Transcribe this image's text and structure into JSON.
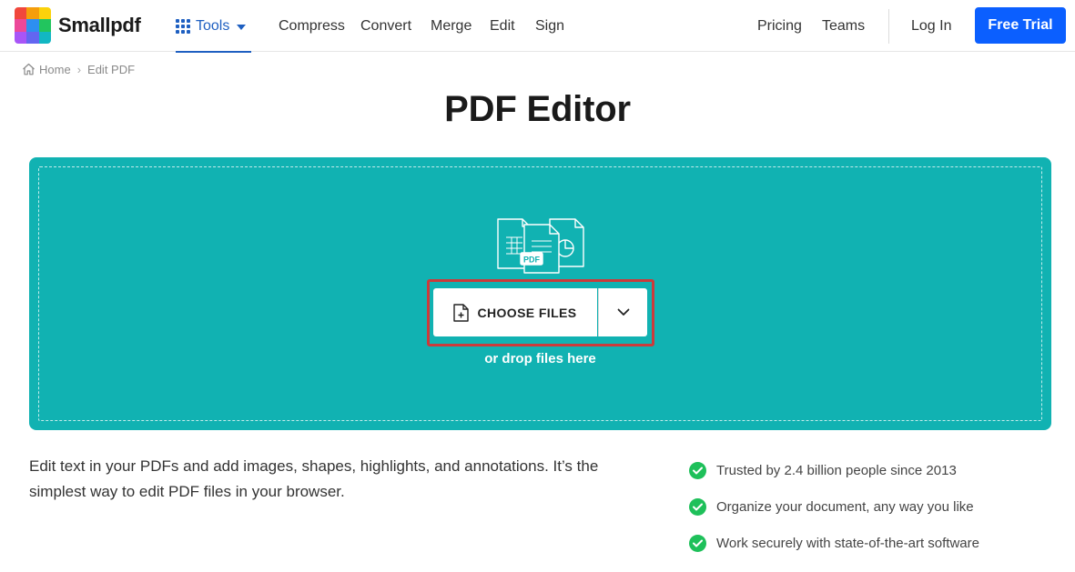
{
  "header": {
    "logo_text": "Smallpdf",
    "logo_colors": [
      "#f1473c",
      "#fbb40b",
      "#2d8ff0",
      "#22c55e",
      "#12b7c3",
      "#a855f7",
      "#e879f9",
      "#8b5cf6",
      "#6366f1"
    ],
    "tools_label": "Tools",
    "nav": [
      "Compress",
      "Convert",
      "Merge",
      "Edit",
      "Sign"
    ],
    "pricing": "Pricing",
    "teams": "Teams",
    "login": "Log In",
    "free_trial": "Free Trial",
    "accent_color": "#1e5fc1",
    "cta_color": "#0b5fff"
  },
  "breadcrumb": {
    "home": "Home",
    "separator": "›",
    "current": "Edit PDF"
  },
  "page_title": "PDF Editor",
  "dropzone": {
    "background_color": "#11b2b2",
    "file_badge": "PDF",
    "choose_label": "CHOOSE FILES",
    "drop_hint": "or drop files here"
  },
  "description": "Edit text in your PDFs and add images, shapes, highlights, and annotations. It’s the simplest way to edit PDF files in your browser.",
  "features": [
    "Trusted by 2.4 billion people since 2013",
    "Organize your document, any way you like",
    "Work securely with state-of-the-art software"
  ],
  "check_color": "#1ec05a"
}
